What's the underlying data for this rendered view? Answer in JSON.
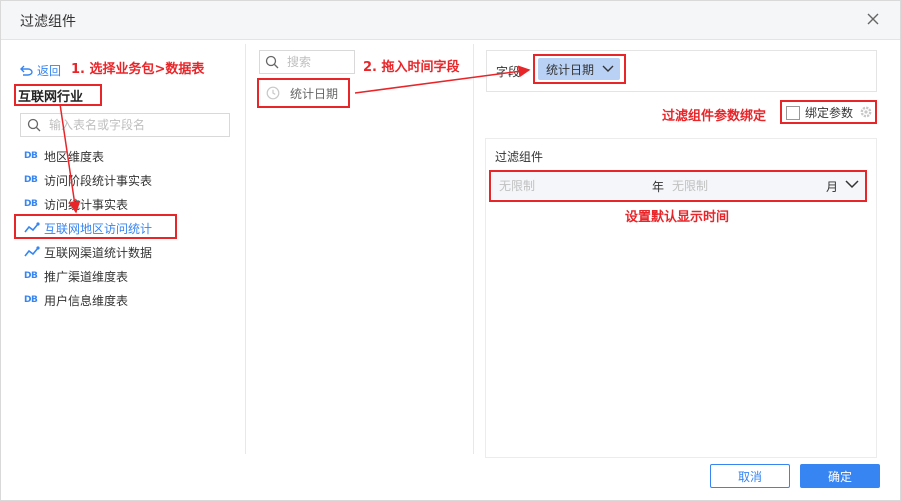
{
  "dialog": {
    "title": "过滤组件"
  },
  "left": {
    "back_label": "返回",
    "package_name": "互联网行业",
    "search_placeholder": "输入表名或字段名",
    "db_tag": "DB",
    "tables": [
      {
        "label": "地区维度表",
        "type": "db"
      },
      {
        "label": "访问阶段统计事实表",
        "type": "db"
      },
      {
        "label": "访问统计事实表",
        "type": "db"
      },
      {
        "label": "互联网地区访问统计",
        "type": "analysis",
        "selected": true
      },
      {
        "label": "互联网渠道统计数据",
        "type": "analysis"
      },
      {
        "label": "推广渠道维度表",
        "type": "db"
      },
      {
        "label": "用户信息维度表",
        "type": "db"
      }
    ]
  },
  "middle": {
    "search_placeholder": "搜索",
    "field_label": "统计日期",
    "field_icon": "clock-icon"
  },
  "right": {
    "field_label": "字段",
    "field_pill": "统计日期",
    "bind_param_label": "绑定参数",
    "bind_param_checked": false,
    "panel_title": "过滤组件",
    "range_start_placeholder": "无限制",
    "range_unit_year": "年",
    "range_end_placeholder": "无限制",
    "range_unit_month": "月"
  },
  "footer": {
    "cancel_label": "取消",
    "ok_label": "确定"
  },
  "annotations": {
    "step1": "1. 选择业务包>数据表",
    "step2": "2. 拖入时间字段",
    "bind": "过滤组件参数绑定",
    "default_time": "设置默认显示时间"
  },
  "colors": {
    "accent": "#3685f2",
    "annotation_red": "#e8262a",
    "pill_bg": "#b9d1f5"
  }
}
